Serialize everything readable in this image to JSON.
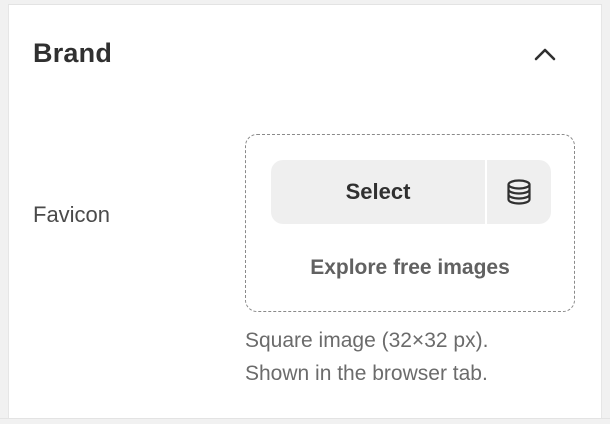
{
  "section": {
    "title": "Brand",
    "collapse_icon": "chevron-up-icon"
  },
  "favicon": {
    "label": "Favicon",
    "select_label": "Select",
    "library_icon": "database-icon",
    "explore_label": "Explore free images",
    "help_line_1": "Square image (32×32 px).",
    "help_line_2": "Shown in the browser tab."
  },
  "colors": {
    "panel_bg": "#ffffff",
    "page_bg": "#f1f1f1",
    "button_bg": "#efefef",
    "text_primary": "#303030",
    "text_secondary": "#6b6b6b"
  }
}
